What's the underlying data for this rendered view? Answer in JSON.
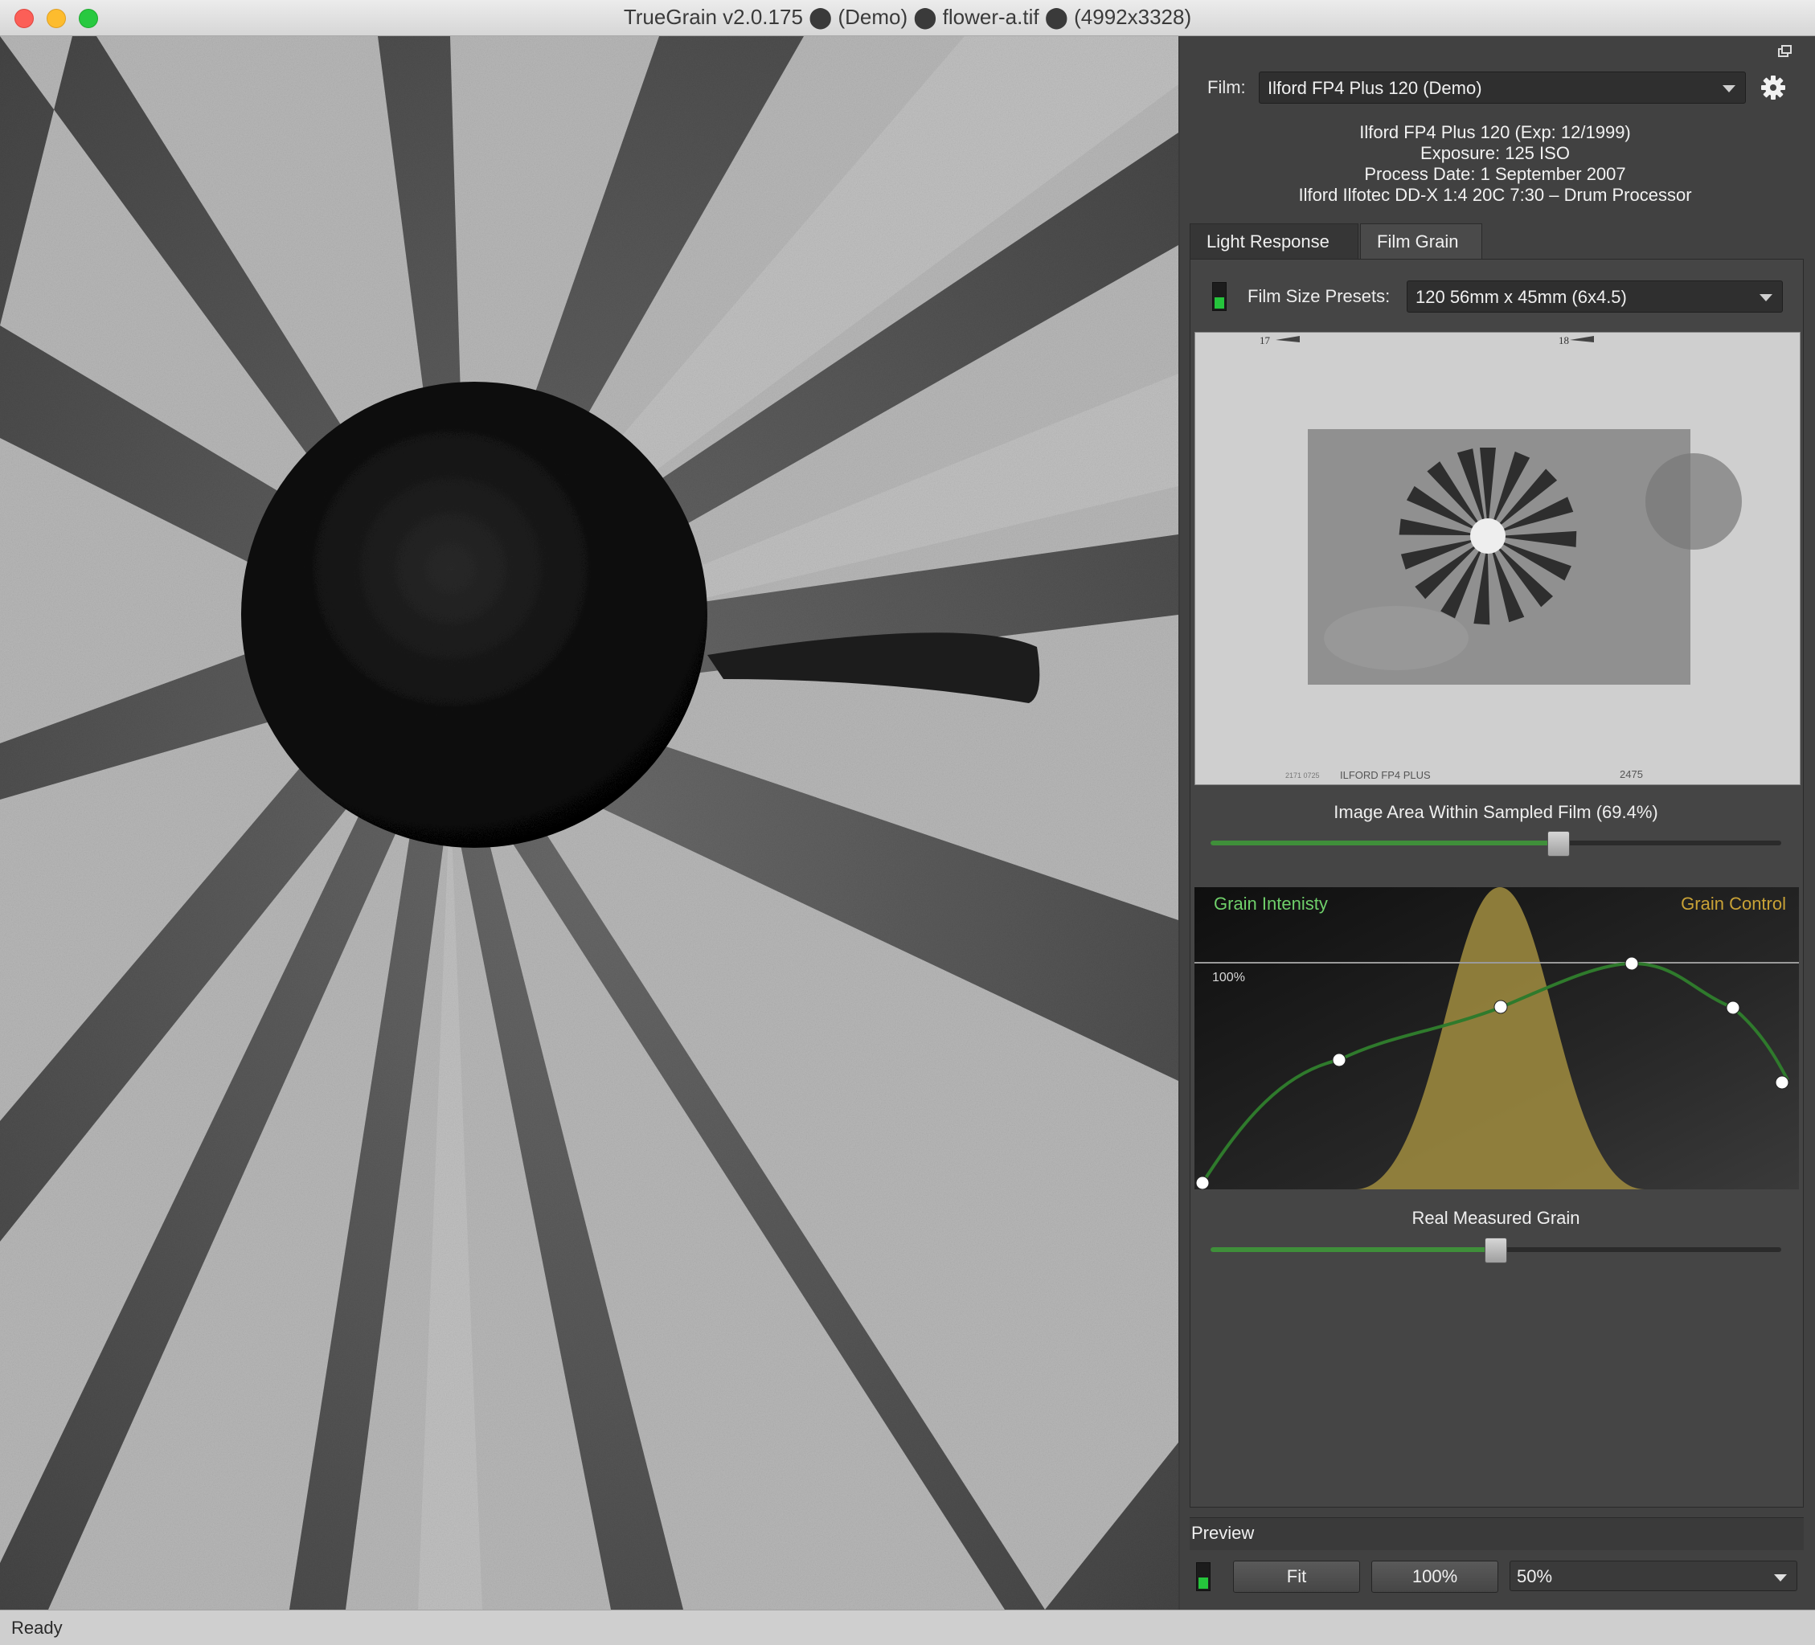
{
  "window": {
    "title": "TrueGrain v2.0.175 ⬤ (Demo) ⬤ flower-a.tif ⬤ (4992x3328)"
  },
  "film": {
    "label": "Film:",
    "selected": "Ilford FP4 Plus 120 (Demo)",
    "info_lines": [
      "Ilford FP4 Plus 120 (Exp: 12/1999)",
      "Exposure: 125 ISO",
      "Process Date: 1 September 2007",
      "Ilford Ilfotec DD-X 1:4 20C 7:30 – Drum Processor"
    ]
  },
  "tabs": [
    {
      "label": "Light Response",
      "active": false
    },
    {
      "label": "Film Grain",
      "active": true
    }
  ],
  "film_grain": {
    "presets_label": "Film Size Presets:",
    "presets_selected": "120 56mm x 45mm (6x4.5)",
    "film_edge": {
      "frame_left": "17",
      "frame_right": "18",
      "brand": "ILFORD FP4 PLUS",
      "code_small": "2171 0725",
      "code_right": "2475"
    },
    "image_area_label": "Image Area Within Sampled Film (69.4%)",
    "image_area_value": 0.61,
    "graph": {
      "left_label": "Grain Intenisty",
      "right_label": "Grain Control",
      "hundred_label": "100%",
      "left_color": "#6fcf6a",
      "right_color": "#c9a236",
      "curve_color": "#2f7a2c",
      "bell_color": "#9d8a3f"
    },
    "real_grain_label": "Real Measured Grain",
    "real_grain_value": 0.5
  },
  "preview": {
    "title": "Preview",
    "fit_label": "Fit",
    "hundred_label": "100%",
    "zoom_selected": "50%"
  },
  "status": {
    "text": "Ready"
  }
}
